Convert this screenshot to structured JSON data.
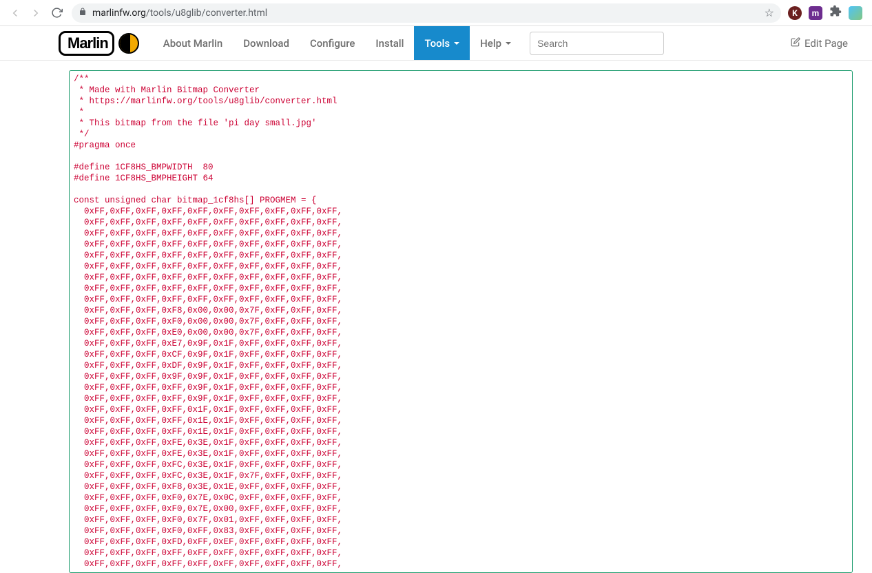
{
  "browser": {
    "url_domain": "marlinfw.org",
    "url_path": "/tools/u8glib/converter.html"
  },
  "nav": {
    "brand": "Marlin",
    "about": "About Marlin",
    "download": "Download",
    "configure": "Configure",
    "install": "Install",
    "tools": "Tools",
    "help": "Help",
    "search_placeholder": "Search",
    "edit_page": "Edit Page"
  },
  "code": {
    "header_comment": "/**\n * Made with Marlin Bitmap Converter\n * https://marlinfw.org/tools/u8glib/converter.html\n *\n * This bitmap from the file 'pi day small.jpg'\n */",
    "pragma": "#pragma once",
    "define_width": "#define 1CF8HS_BMPWIDTH  80",
    "define_height": "#define 1CF8HS_BMPHEIGHT 64",
    "array_decl": "const unsigned char bitmap_1cf8hs[] PROGMEM = {",
    "rows": [
      "0xFF,0xFF,0xFF,0xFF,0xFF,0xFF,0xFF,0xFF,0xFF,0xFF,",
      "0xFF,0xFF,0xFF,0xFF,0xFF,0xFF,0xFF,0xFF,0xFF,0xFF,",
      "0xFF,0xFF,0xFF,0xFF,0xFF,0xFF,0xFF,0xFF,0xFF,0xFF,",
      "0xFF,0xFF,0xFF,0xFF,0xFF,0xFF,0xFF,0xFF,0xFF,0xFF,",
      "0xFF,0xFF,0xFF,0xFF,0xFF,0xFF,0xFF,0xFF,0xFF,0xFF,",
      "0xFF,0xFF,0xFF,0xFF,0xFF,0xFF,0xFF,0xFF,0xFF,0xFF,",
      "0xFF,0xFF,0xFF,0xFF,0xFF,0xFF,0xFF,0xFF,0xFF,0xFF,",
      "0xFF,0xFF,0xFF,0xFF,0xFF,0xFF,0xFF,0xFF,0xFF,0xFF,",
      "0xFF,0xFF,0xFF,0xFF,0xFF,0xFF,0xFF,0xFF,0xFF,0xFF,",
      "0xFF,0xFF,0xFF,0xF8,0x00,0x00,0x7F,0xFF,0xFF,0xFF,",
      "0xFF,0xFF,0xFF,0xF0,0x00,0x00,0x7F,0xFF,0xFF,0xFF,",
      "0xFF,0xFF,0xFF,0xE0,0x00,0x00,0x7F,0xFF,0xFF,0xFF,",
      "0xFF,0xFF,0xFF,0xE7,0x9F,0x1F,0xFF,0xFF,0xFF,0xFF,",
      "0xFF,0xFF,0xFF,0xCF,0x9F,0x1F,0xFF,0xFF,0xFF,0xFF,",
      "0xFF,0xFF,0xFF,0xDF,0x9F,0x1F,0xFF,0xFF,0xFF,0xFF,",
      "0xFF,0xFF,0xFF,0x9F,0x9F,0x1F,0xFF,0xFF,0xFF,0xFF,",
      "0xFF,0xFF,0xFF,0xFF,0x9F,0x1F,0xFF,0xFF,0xFF,0xFF,",
      "0xFF,0xFF,0xFF,0xFF,0x9F,0x1F,0xFF,0xFF,0xFF,0xFF,",
      "0xFF,0xFF,0xFF,0xFF,0x1F,0x1F,0xFF,0xFF,0xFF,0xFF,",
      "0xFF,0xFF,0xFF,0xFF,0x1E,0x1F,0xFF,0xFF,0xFF,0xFF,",
      "0xFF,0xFF,0xFF,0xFF,0x1E,0x1F,0xFF,0xFF,0xFF,0xFF,",
      "0xFF,0xFF,0xFF,0xFE,0x3E,0x1F,0xFF,0xFF,0xFF,0xFF,",
      "0xFF,0xFF,0xFF,0xFE,0x3E,0x1F,0xFF,0xFF,0xFF,0xFF,",
      "0xFF,0xFF,0xFF,0xFC,0x3E,0x1F,0xFF,0xFF,0xFF,0xFF,",
      "0xFF,0xFF,0xFF,0xFC,0x3E,0x1F,0x7F,0xFF,0xFF,0xFF,",
      "0xFF,0xFF,0xFF,0xF8,0x3E,0x1E,0xFF,0xFF,0xFF,0xFF,",
      "0xFF,0xFF,0xFF,0xF0,0x7E,0x0C,0xFF,0xFF,0xFF,0xFF,",
      "0xFF,0xFF,0xFF,0xF0,0x7E,0x00,0xFF,0xFF,0xFF,0xFF,",
      "0xFF,0xFF,0xFF,0xF0,0x7F,0x01,0xFF,0xFF,0xFF,0xFF,",
      "0xFF,0xFF,0xFF,0xF0,0xFF,0x83,0xFF,0xFF,0xFF,0xFF,",
      "0xFF,0xFF,0xFF,0xFD,0xFF,0xEF,0xFF,0xFF,0xFF,0xFF,",
      "0xFF,0xFF,0xFF,0xFF,0xFF,0xFF,0xFF,0xFF,0xFF,0xFF,",
      "0xFF,0xFF,0xFF,0xFF,0xFF,0xFF,0xFF,0xFF,0xFF,0xFF,"
    ]
  }
}
